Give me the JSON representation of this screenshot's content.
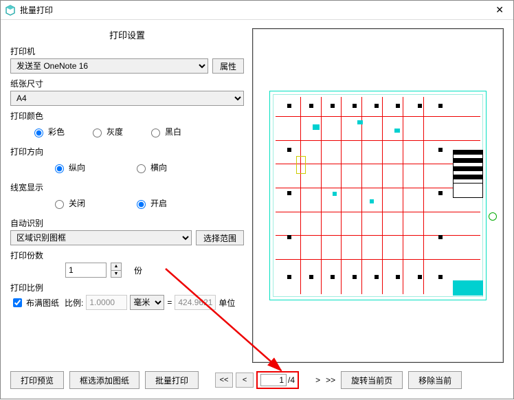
{
  "window": {
    "title": "批量打印",
    "close": "✕"
  },
  "settings_title": "打印设置",
  "printer": {
    "label": "打印机",
    "selected": "发送至 OneNote 16",
    "properties_btn": "属性"
  },
  "paper": {
    "label": "纸张尺寸",
    "selected": "A4"
  },
  "color": {
    "label": "打印颜色",
    "options": {
      "color": "彩色",
      "gray": "灰度",
      "bw": "黑白"
    },
    "selected": "color"
  },
  "orientation": {
    "label": "打印方向",
    "options": {
      "portrait": "纵向",
      "landscape": "横向"
    },
    "selected": "portrait"
  },
  "linewidth": {
    "label": "线宽显示",
    "options": {
      "off": "关闭",
      "on": "开启"
    },
    "selected": "on"
  },
  "auto_detect": {
    "label": "自动识别",
    "selected": "区域识别图框",
    "range_btn": "选择范围"
  },
  "copies": {
    "label": "打印份数",
    "value": "1",
    "unit": "份"
  },
  "ratio": {
    "label": "打印比例",
    "fill_label": "布满图纸",
    "fill_checked": true,
    "ratio_label": "比例:",
    "ratio_value": "1.0000",
    "unit_selected": "毫米",
    "equals": "=",
    "result": "424.9621",
    "result_unit": "单位"
  },
  "footer": {
    "preview_btn": "打印预览",
    "add_frame_btn": "框选添加图纸",
    "batch_print_btn": "批量打印",
    "first": "<<",
    "prev": "<",
    "page_current": "1",
    "page_total": "/4",
    "next": ">",
    "last": ">>",
    "rotate_btn": "旋转当前页",
    "remove_btn": "移除当前"
  }
}
